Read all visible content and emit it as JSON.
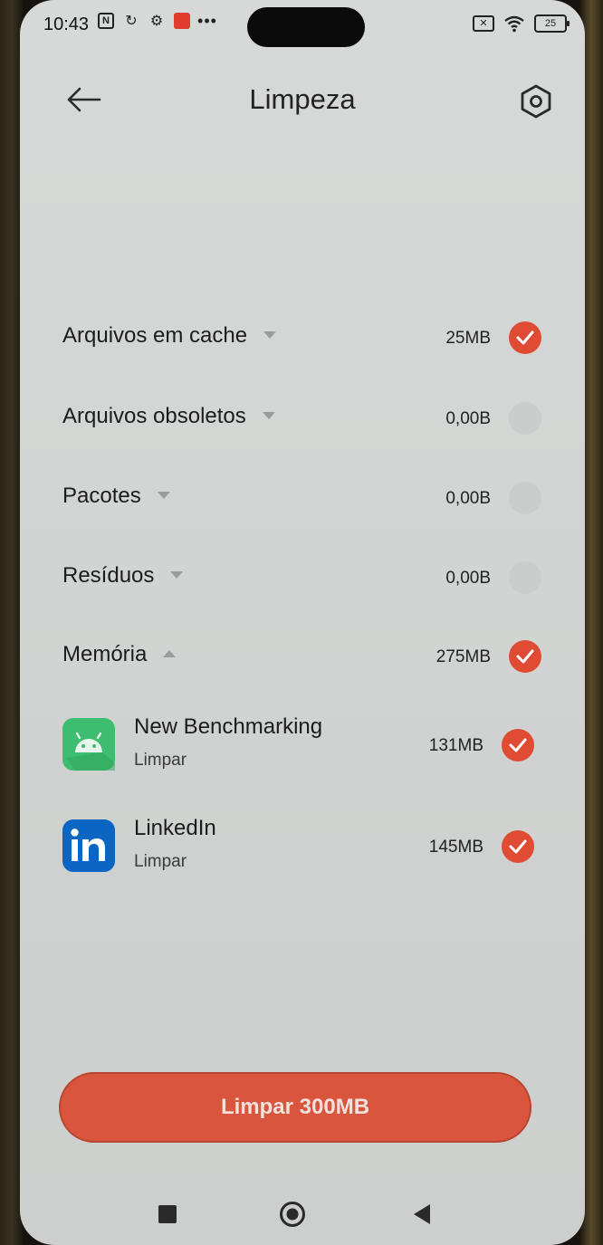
{
  "status_bar": {
    "time": "10:43",
    "battery": "25"
  },
  "header": {
    "title": "Limpeza"
  },
  "categories": [
    {
      "label": "Arquivos em cache",
      "size": "25MB",
      "checked": true,
      "expanded": false
    },
    {
      "label": "Arquivos obsoletos",
      "size": "0,00B",
      "checked": false,
      "expanded": false
    },
    {
      "label": "Pacotes",
      "size": "0,00B",
      "checked": false,
      "expanded": false
    },
    {
      "label": "Resíduos",
      "size": "0,00B",
      "checked": false,
      "expanded": false
    },
    {
      "label": "Memória",
      "size": "275MB",
      "checked": true,
      "expanded": true
    }
  ],
  "apps": [
    {
      "name": "New Benchmarking",
      "action": "Limpar",
      "size": "131MB",
      "checked": true,
      "icon": "android-icon"
    },
    {
      "name": "LinkedIn",
      "action": "Limpar",
      "size": "145MB",
      "checked": true,
      "icon": "linkedin-icon"
    }
  ],
  "clean_button": {
    "label": "Limpar 300MB"
  },
  "colors": {
    "accent": "#e04b33",
    "button": "#d9553e",
    "android_green": "#3dbd6f",
    "linkedin_blue": "#0a66c2"
  }
}
